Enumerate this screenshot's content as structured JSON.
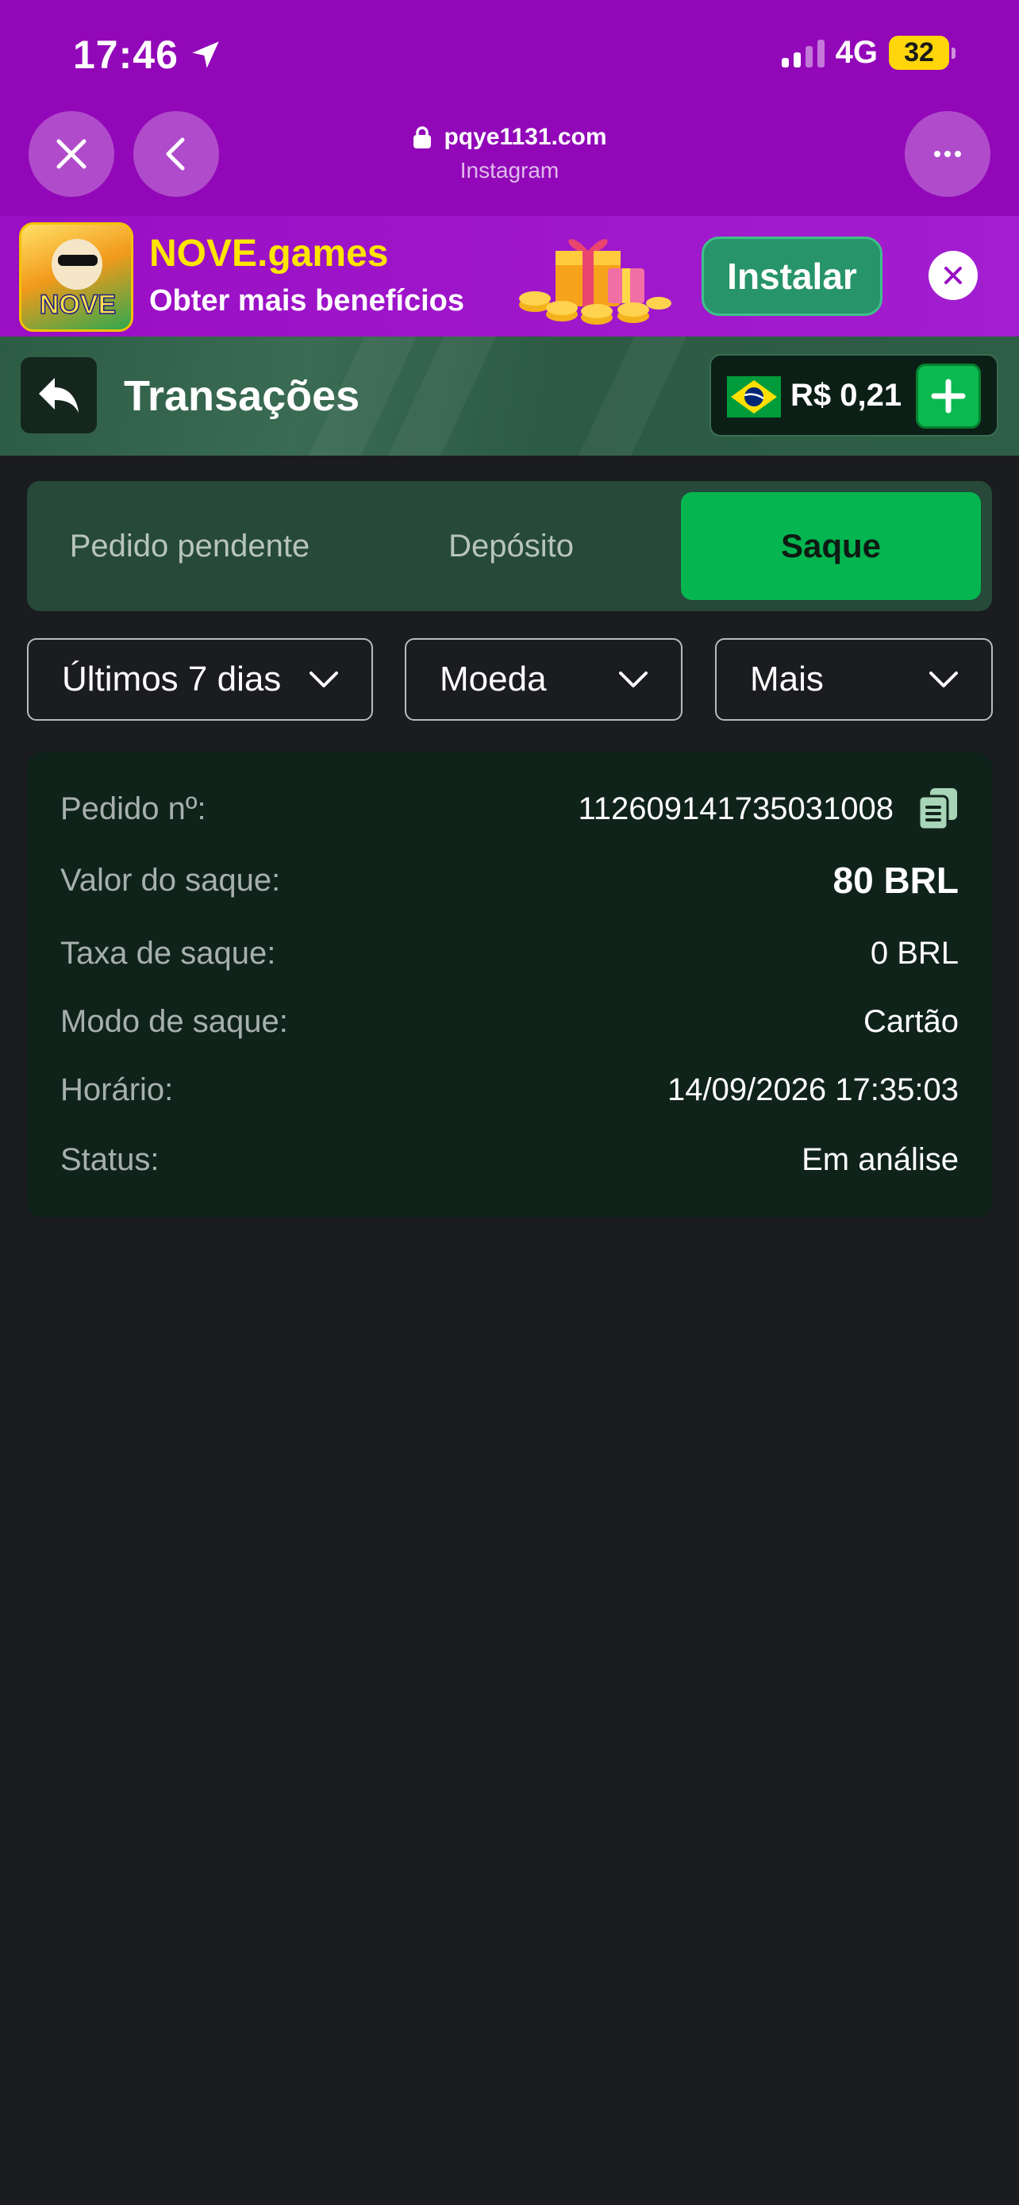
{
  "status_bar": {
    "time": "17:46",
    "network": "4G",
    "battery": "32"
  },
  "browser": {
    "url": "pqye1131.com",
    "source": "Instagram"
  },
  "banner": {
    "logo_text": "NOVE",
    "title": "NOVE.games",
    "subtitle": "Obter mais benefícios",
    "install_label": "Instalar"
  },
  "header": {
    "title": "Transações",
    "balance": "R$ 0,21"
  },
  "tabs": [
    {
      "label": "Pedido pendente",
      "active": false
    },
    {
      "label": "Depósito",
      "active": false
    },
    {
      "label": "Saque",
      "active": true
    }
  ],
  "filters": {
    "period": "Últimos 7 dias",
    "currency": "Moeda",
    "more": "Mais"
  },
  "transaction": {
    "order_label": "Pedido nº:",
    "order_value": "1126091417350310​08",
    "amount_label": "Valor do saque:",
    "amount_value": "80 BRL",
    "fee_label": "Taxa de saque:",
    "fee_value": "0 BRL",
    "mode_label": "Modo de saque:",
    "mode_value": "Cartão",
    "time_label": "Horário:",
    "time_value": "14/09/2026 17:35:03",
    "status_label": "Status:",
    "status_value": "Em análise"
  },
  "colors": {
    "browser_bar": "#9208b8",
    "header_green": "#2f5e47",
    "active_tab": "#04b550",
    "card_bg": "#10231b",
    "page_bg": "#1b1c20"
  }
}
